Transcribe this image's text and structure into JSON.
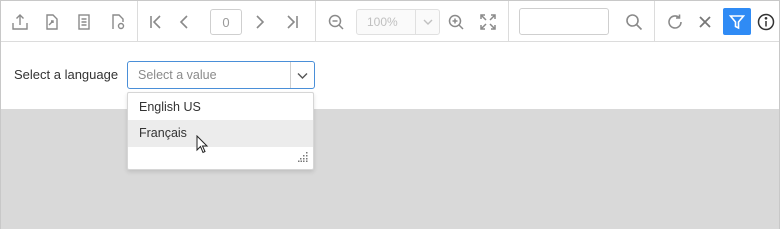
{
  "toolbar": {
    "page_number": "0",
    "zoom_value": "100%",
    "search_value": "",
    "accent_color": "#2f8bf5",
    "icons": [
      "export-icon",
      "print-icon",
      "document-map-icon",
      "parameters-icon",
      "first-page-icon",
      "previous-page-icon",
      "next-page-icon",
      "last-page-icon",
      "zoom-out-icon",
      "zoom-in-icon",
      "fit-page-icon",
      "search-icon",
      "refresh-icon",
      "close-icon",
      "filter-icon",
      "info-icon"
    ]
  },
  "parameter": {
    "label": "Select a language",
    "placeholder": "Select a value",
    "options": [
      "English US",
      "Français"
    ],
    "hovered_option": "Français"
  }
}
